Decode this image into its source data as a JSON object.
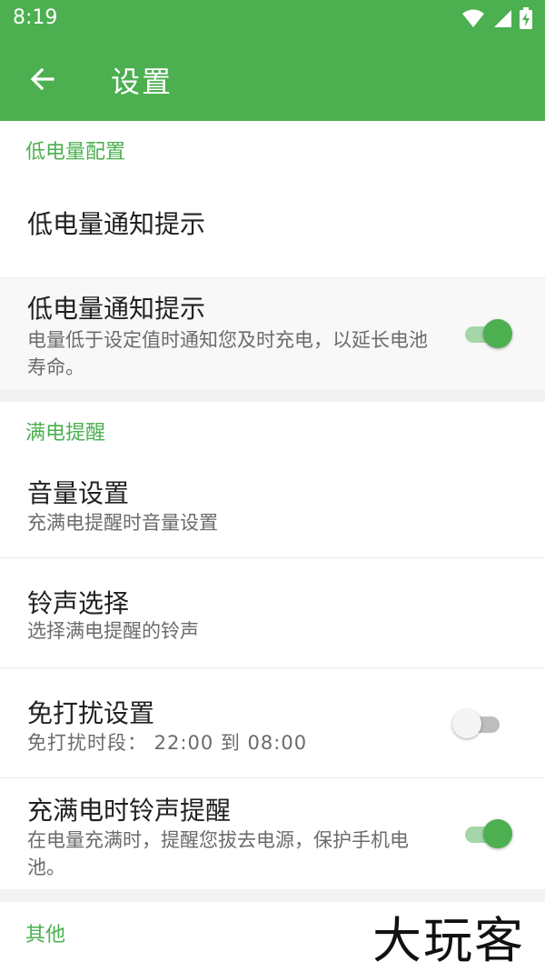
{
  "status": {
    "time": "8:19"
  },
  "appbar": {
    "title": "设置"
  },
  "sections": {
    "low_battery": {
      "header": "低电量配置",
      "item1_title": "低电量通知提示",
      "item2_title": "低电量通知提示",
      "item2_sub": "电量低于设定值时通知您及时充电，以延长电池寿命。",
      "item2_toggle": true
    },
    "full_charge": {
      "header": "满电提醒",
      "volume_title": "音量设置",
      "volume_sub": "充满电提醒时音量设置",
      "ringtone_title": "铃声选择",
      "ringtone_sub": "选择满电提醒的铃声",
      "dnd_title": "免打扰设置",
      "dnd_sub": "免打扰时段： 22:00 到 08:00",
      "dnd_toggle": false,
      "ring_title": "充满电时铃声提醒",
      "ring_sub": "在电量充满时，提醒您拔去电源，保护手机电池。",
      "ring_toggle": true
    },
    "other": {
      "header": "其他"
    }
  },
  "watermark": "大玩客",
  "colors": {
    "accent": "#4caf50",
    "accent_light": "#a5d6a7"
  }
}
